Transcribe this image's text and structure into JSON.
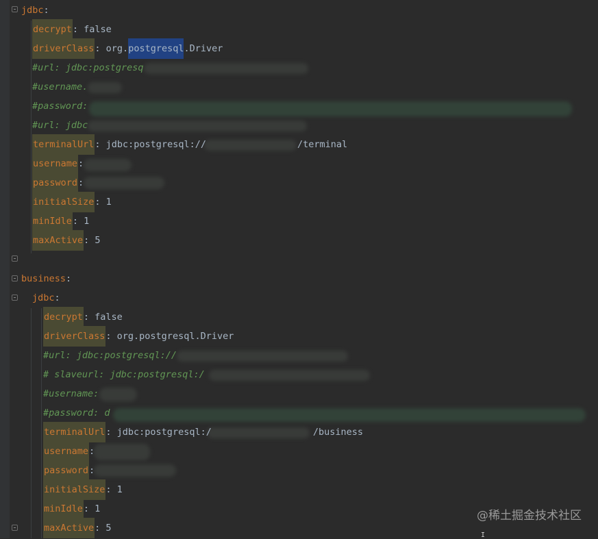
{
  "jdbc": {
    "section": "jdbc",
    "decrypt_key": "decrypt",
    "decrypt_val": ": false",
    "driver_key": "driverClass",
    "driver_pre": ": org.",
    "driver_sel": "postgresql",
    "driver_post": ".Driver",
    "c_url": "#url: jdbc:postgresq",
    "c_username": "#username.",
    "c_password": "#password: ",
    "c_url2": "#url: jdbc",
    "terminal_key": "terminalUrl",
    "terminal_pre": ": jdbc:postgresql://",
    "terminal_post": "/terminal",
    "username_key": "username",
    "username_val": ":",
    "password_key": "password",
    "password_val": ":",
    "initial_key": "initialSize",
    "initial_val": ": 1",
    "minidle_key": "minIdle",
    "minidle_val": ": 1",
    "maxactive_key": "maxActive",
    "maxactive_val": ": 5"
  },
  "business": {
    "section": "business",
    "sub": "jdbc",
    "decrypt_key": "decrypt",
    "decrypt_val": ": false",
    "driver_key": "driverClass",
    "driver_val": ": org.postgresql.Driver",
    "c_url": "#url: jdbc:postgresql://",
    "c_slave": "#  slaveurl: jdbc:postgresql:/",
    "c_username": "#username:",
    "c_password": "#password: d",
    "terminal_key": "terminalUrl",
    "terminal_pre": ": jdbc:postgresql:/",
    "terminal_post": "/business",
    "username_key": "username",
    "username_val": ":",
    "password_key": "password",
    "password_val": ":",
    "initial_key": "initialSize",
    "initial_val": ": 1",
    "minidle_key": "minIdle",
    "minidle_val": ": 1",
    "maxactive_key": "maxActive",
    "maxactive_val": ": 5"
  },
  "watermark": "@稀土掘金技术社区",
  "colors": {
    "background": "#2b2b2b",
    "key": "#cc7832",
    "comment": "#629755",
    "selection": "#214283"
  }
}
